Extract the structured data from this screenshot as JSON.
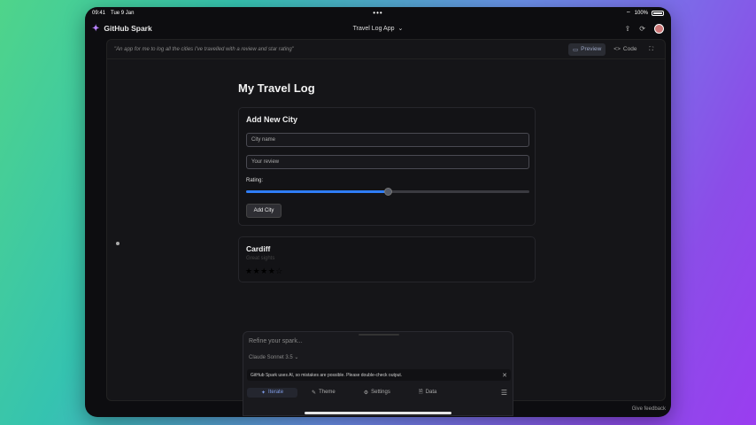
{
  "statusbar": {
    "time": "09:41",
    "date": "Tue 9 Jan",
    "battery": "100%"
  },
  "nav": {
    "brand": "GitHub Spark",
    "app_title": "Travel Log App"
  },
  "prompt": {
    "text": "\"An app for me to log all the cities I've travelled with a review and star rating\"",
    "preview_label": "Preview",
    "code_label": "Code"
  },
  "app": {
    "title": "My Travel Log",
    "form": {
      "heading": "Add New City",
      "city_placeholder": "City name",
      "review_placeholder": "Your review",
      "rating_label": "Rating:",
      "rating_value_fraction": 0.5,
      "submit_label": "Add City"
    },
    "entries": [
      {
        "city": "Cardiff",
        "review": "Great sights",
        "stars": "★★★★☆",
        "rating": 4
      }
    ]
  },
  "chat": {
    "placeholder": "Refine your spark...",
    "model": "Claude Sonnet 3.5 ⌄",
    "notice": "GitHub Spark uses AI, so mistakes are possible. Please double-check output.",
    "tabs": [
      {
        "label": "Iterate",
        "icon": "✦"
      },
      {
        "label": "Theme",
        "icon": "✎"
      },
      {
        "label": "Settings",
        "icon": "⚙"
      },
      {
        "label": "Data",
        "icon": "🗎"
      }
    ]
  },
  "footer": {
    "feedback": "Give feedback"
  },
  "colors": {
    "accent": "#2f7df6",
    "star": "#f6d34a"
  }
}
